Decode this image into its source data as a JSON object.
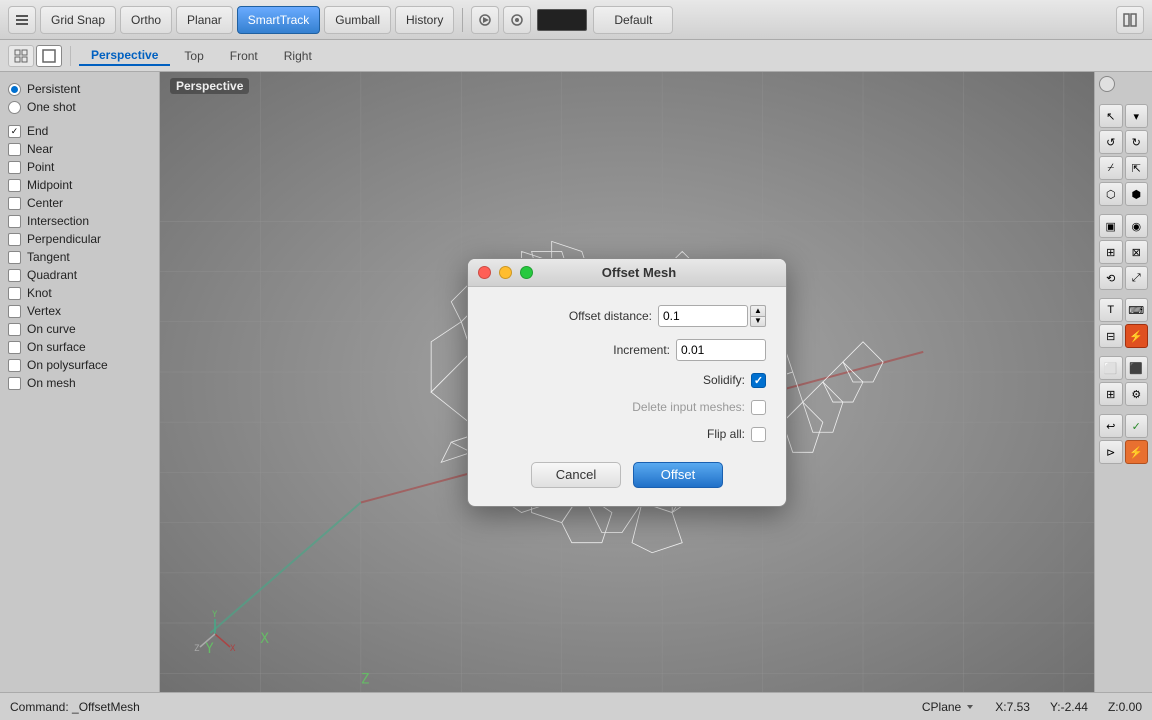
{
  "toolbar": {
    "grid_snap": "Grid Snap",
    "ortho": "Ortho",
    "planar": "Planar",
    "smarttrack": "SmartTrack",
    "gumball": "Gumball",
    "history": "History",
    "default_label": "Default"
  },
  "viewport_tabs": {
    "perspective": "Perspective",
    "top": "Top",
    "front": "Front",
    "right": "Right"
  },
  "viewport_label": "Perspective",
  "snap_panel": {
    "persistent_label": "Persistent",
    "one_shot_label": "One shot",
    "end_label": "End",
    "near_label": "Near",
    "point_label": "Point",
    "midpoint_label": "Midpoint",
    "center_label": "Center",
    "intersection_label": "Intersection",
    "perpendicular_label": "Perpendicular",
    "tangent_label": "Tangent",
    "quadrant_label": "Quadrant",
    "knot_label": "Knot",
    "vertex_label": "Vertex",
    "on_curve_label": "On curve",
    "on_surface_label": "On surface",
    "on_polysurface_label": "On polysurface",
    "on_mesh_label": "On mesh"
  },
  "dialog": {
    "title": "Offset Mesh",
    "offset_distance_label": "Offset distance:",
    "offset_distance_value": "0.1",
    "increment_label": "Increment:",
    "increment_value": "0.01",
    "solidify_label": "Solidify:",
    "solidify_checked": true,
    "delete_input_label": "Delete input meshes:",
    "delete_input_checked": false,
    "flip_all_label": "Flip all:",
    "flip_all_checked": false,
    "cancel_btn": "Cancel",
    "offset_btn": "Offset"
  },
  "statusbar": {
    "command": "Command: _OffsetMesh",
    "cplane": "CPlane",
    "x": "X:7.53",
    "y": "Y:-2.44",
    "z": "Z:0.00"
  }
}
